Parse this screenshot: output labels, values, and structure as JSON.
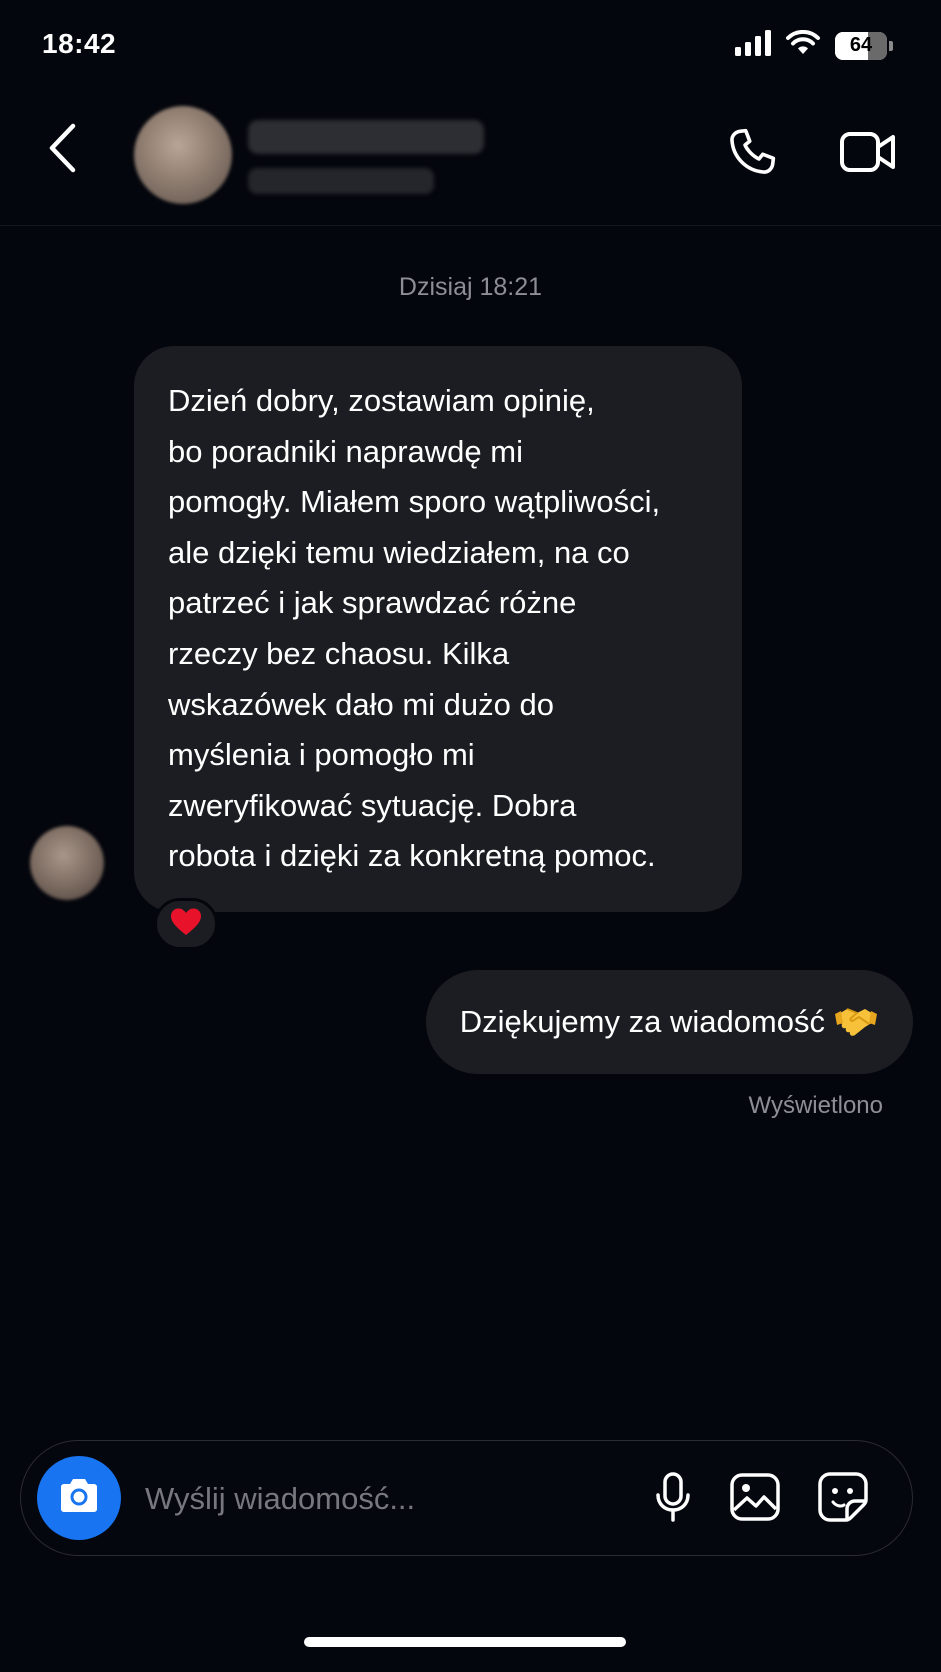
{
  "status_bar": {
    "time": "18:42",
    "battery_level": "64",
    "battery_fraction": 0.64,
    "icons": [
      "signal-icon",
      "wifi-icon",
      "battery-icon"
    ]
  },
  "header": {
    "back_icon": "chevron-left-icon",
    "call_icon": "phone-icon",
    "video_icon": "video-camera-icon"
  },
  "conversation": {
    "timestamp": "Dzisiaj 18:21",
    "messages": [
      {
        "direction": "incoming",
        "text": "Dzień dobry, zostawiam opinię,\nbo poradniki naprawdę mi\npomogły. Miałem sporo wątpliwości,\nale dzięki temu wiedziałem, na co\npatrzeć i jak sprawdzać różne\nrzeczy bez chaosu. Kilka\nwskazówek dało mi dużo do\nmyślenia i pomogło mi\nzweryfikować sytuację. Dobra\nrobota i dzięki za konkretną pomoc.",
        "reaction": "heart-icon"
      },
      {
        "direction": "outgoing",
        "text": "Dziękujemy za wiadomość",
        "emoji": "handshake-icon"
      }
    ],
    "seen_label": "Wyświetlono"
  },
  "composer": {
    "placeholder": "Wyślij wiadomość...",
    "value": "",
    "icons": [
      "camera-icon",
      "microphone-icon",
      "gallery-icon",
      "sticker-icon"
    ]
  },
  "colors": {
    "background": "#04060d",
    "bubble": "#1c1d22",
    "accent": "#1874f1",
    "muted_text": "#8e8f94"
  }
}
